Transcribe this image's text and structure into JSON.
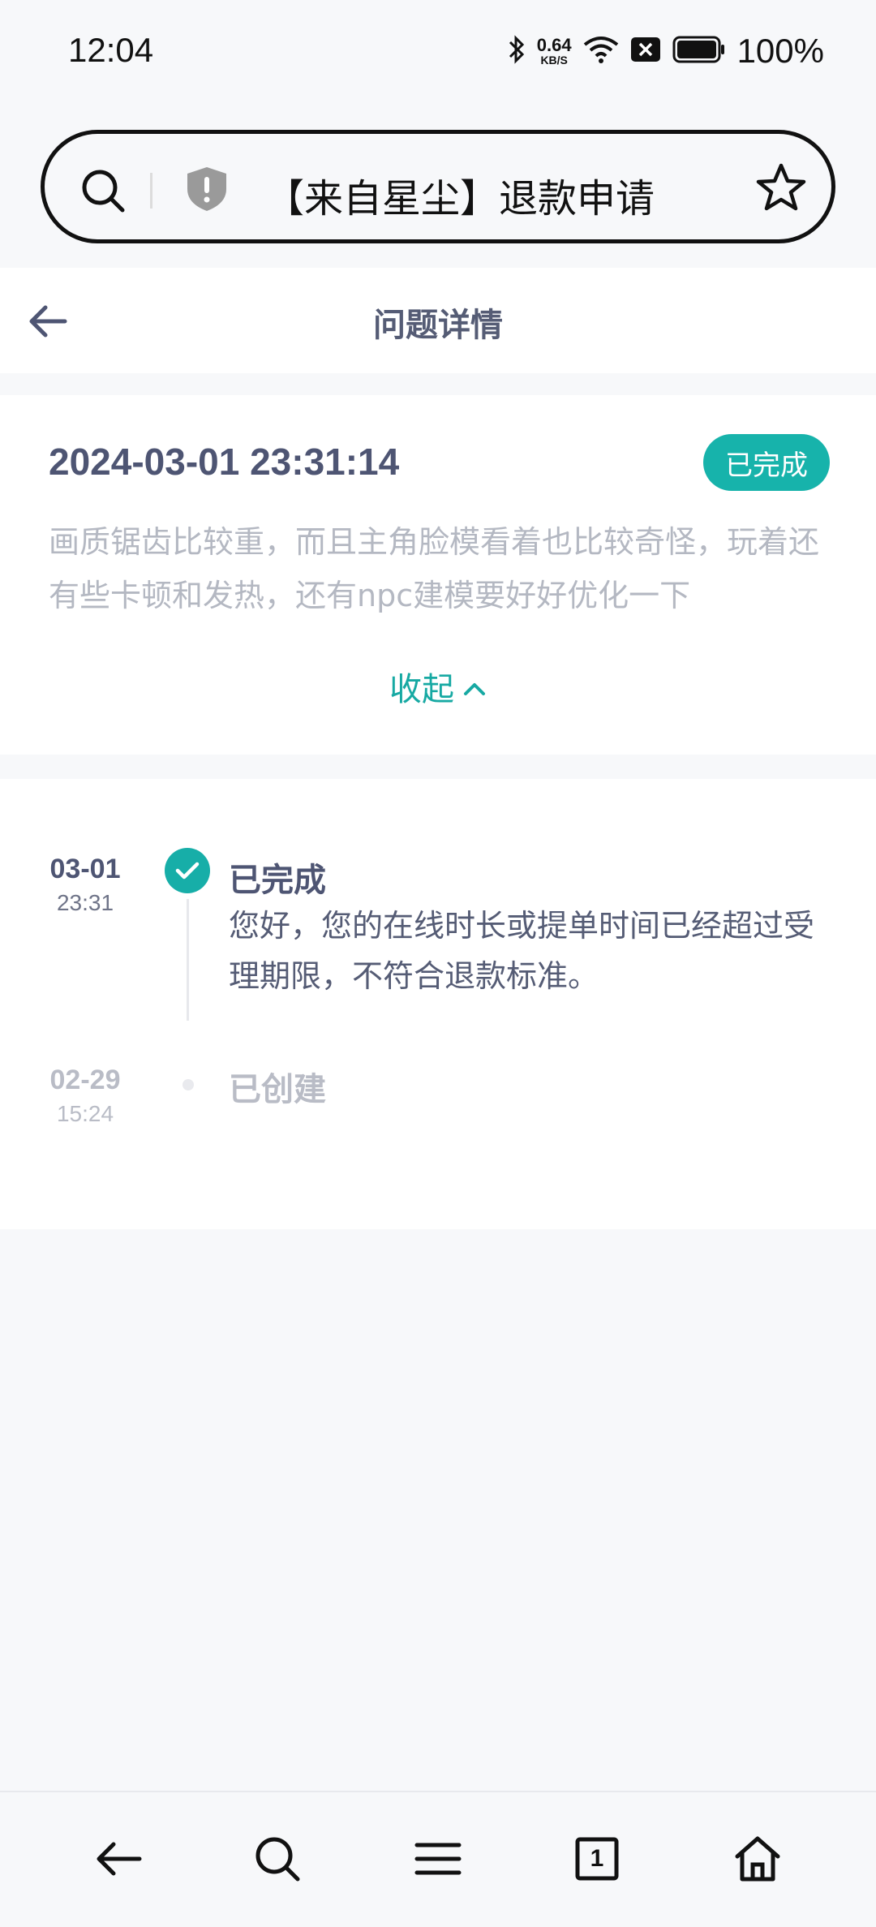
{
  "status_bar": {
    "time": "12:04",
    "net_speed_value": "0.64",
    "net_speed_unit": "KB/S",
    "battery": "100%"
  },
  "browser": {
    "page_title": "【来自星尘】退款申请"
  },
  "header": {
    "title": "问题详情"
  },
  "ticket": {
    "datetime": "2024-03-01 23:31:14",
    "status": "已完成",
    "description": "画质锯齿比较重，而且主角脸模看着也比较奇怪，玩着还有些卡顿和发热，还有npc建模要好好优化一下",
    "collapse_label": "收起"
  },
  "timeline": [
    {
      "date": "03-01",
      "time": "23:31",
      "status": "已完成",
      "message": "您好，您的在线时长或提单时间已经超过受理期限，不符合退款标准。"
    },
    {
      "date": "02-29",
      "time": "15:24",
      "status": "已创建"
    }
  ],
  "colors": {
    "accent": "#17b3ab",
    "heading": "#4e5573",
    "muted": "#b4b8c2"
  },
  "icons": {
    "nav": [
      "back-icon",
      "search-icon",
      "menu-icon",
      "tabs-icon",
      "home-icon"
    ],
    "tabs_count": "1"
  }
}
